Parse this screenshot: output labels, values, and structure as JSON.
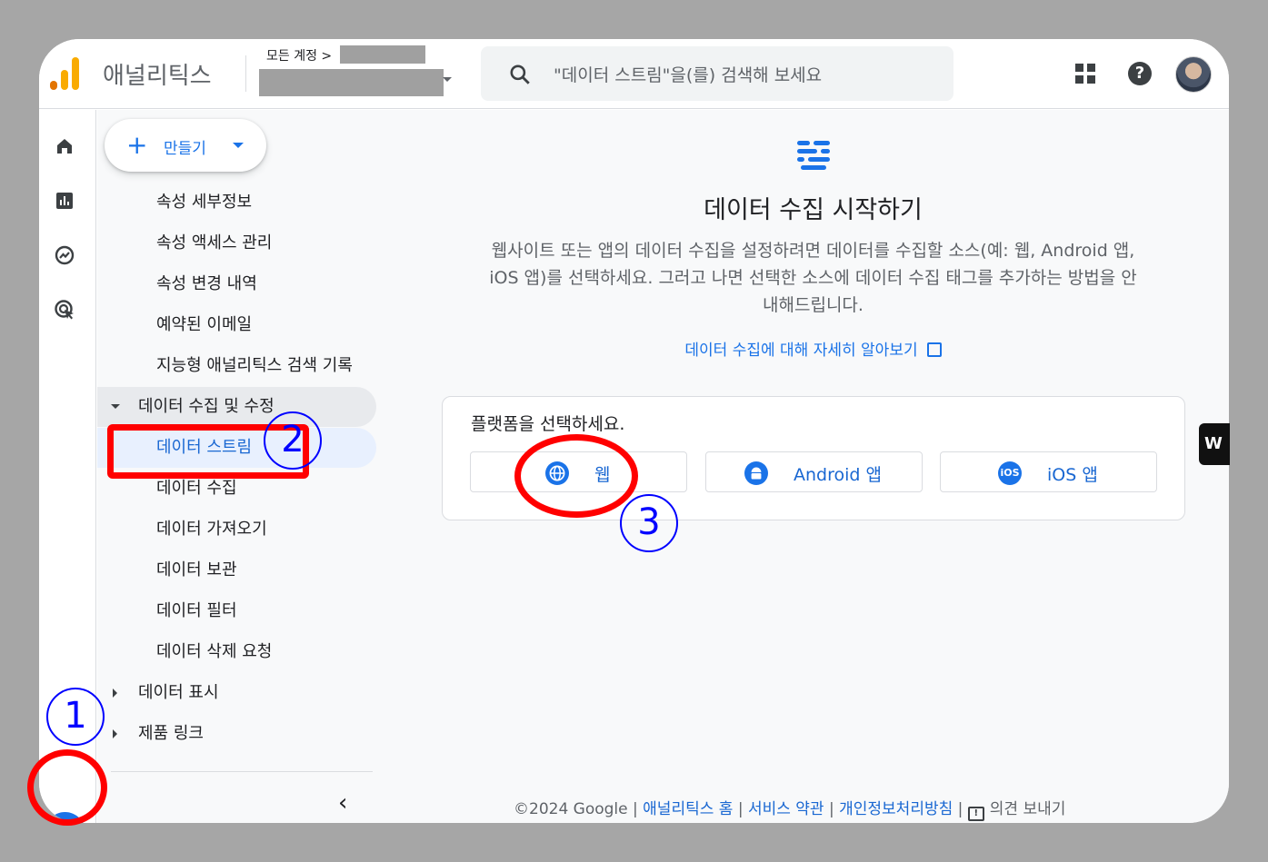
{
  "header": {
    "app_title": "애널리틱스",
    "account_crumb": "모든 계정 >",
    "search_placeholder": "\"데이터 스트림\"을(를) 검색해 보세요"
  },
  "create_button": {
    "label": "만들기"
  },
  "side_menu": {
    "items": [
      {
        "label": "속성 세부정보"
      },
      {
        "label": "속성 액세스 관리"
      },
      {
        "label": "속성 변경 내역"
      },
      {
        "label": "예약된 이메일"
      },
      {
        "label": "지능형 애널리틱스 검색 기록"
      },
      {
        "label": "데이터 수집 및 수정"
      },
      {
        "label": "데이터 스트림"
      },
      {
        "label": "데이터 수집"
      },
      {
        "label": "데이터 가져오기"
      },
      {
        "label": "데이터 보관"
      },
      {
        "label": "데이터 필터"
      },
      {
        "label": "데이터 삭제 요청"
      },
      {
        "label": "데이터 표시"
      },
      {
        "label": "제품 링크"
      }
    ]
  },
  "main": {
    "title": "데이터 수집 시작하기",
    "description": "웹사이트 또는 앱의 데이터 수집을 설정하려면 데이터를 수집할 소스(예: 웹, Android 앱, iOS 앱)를 선택하세요. 그러고 나면 선택한 소스에 데이터 수집 태그를 추가하는 방법을 안내해드립니다.",
    "learn_more": "데이터 수집에 대해 자세히 알아보기",
    "platform_prompt": "플랫폼을 선택하세요.",
    "platforms": [
      {
        "label": "웹",
        "icon": "globe-icon"
      },
      {
        "label": "Android 앱",
        "icon": "android-icon"
      },
      {
        "label": "iOS 앱",
        "icon": "ios-icon"
      }
    ]
  },
  "footer": {
    "copyright": "©2024 Google",
    "home": "애널리틱스 홈",
    "terms": "서비스 약관",
    "privacy": "개인정보처리방침",
    "feedback": "의견 보내기"
  },
  "annotations": {
    "n1": "1",
    "n2": "2",
    "n3": "3"
  },
  "colors": {
    "accent": "#1a73e8",
    "annotation_red": "#ff0000",
    "annotation_blue": "#0000ff"
  }
}
